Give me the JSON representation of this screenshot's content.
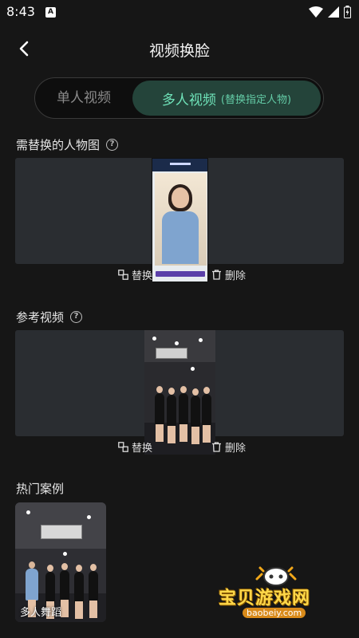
{
  "status_bar": {
    "time": "8:43",
    "app_icon": "A"
  },
  "header": {
    "title": "视频换脸",
    "back_icon": "chevron-left-icon"
  },
  "mode_tabs": {
    "single": "单人视频",
    "multi": "多人视频",
    "multi_note": "(替换指定人物)",
    "active": "multi",
    "active_color": "#6fe3b9"
  },
  "face_section": {
    "label": "需替换的人物图",
    "replace": "替换",
    "delete": "删除"
  },
  "video_section": {
    "label": "参考视频",
    "replace": "替换",
    "delete": "删除"
  },
  "cases_section": {
    "label": "热门案例",
    "items": [
      {
        "label": "多人舞蹈"
      }
    ]
  },
  "watermark": {
    "text": "宝贝游戏网",
    "url": "baobeiy.com"
  }
}
